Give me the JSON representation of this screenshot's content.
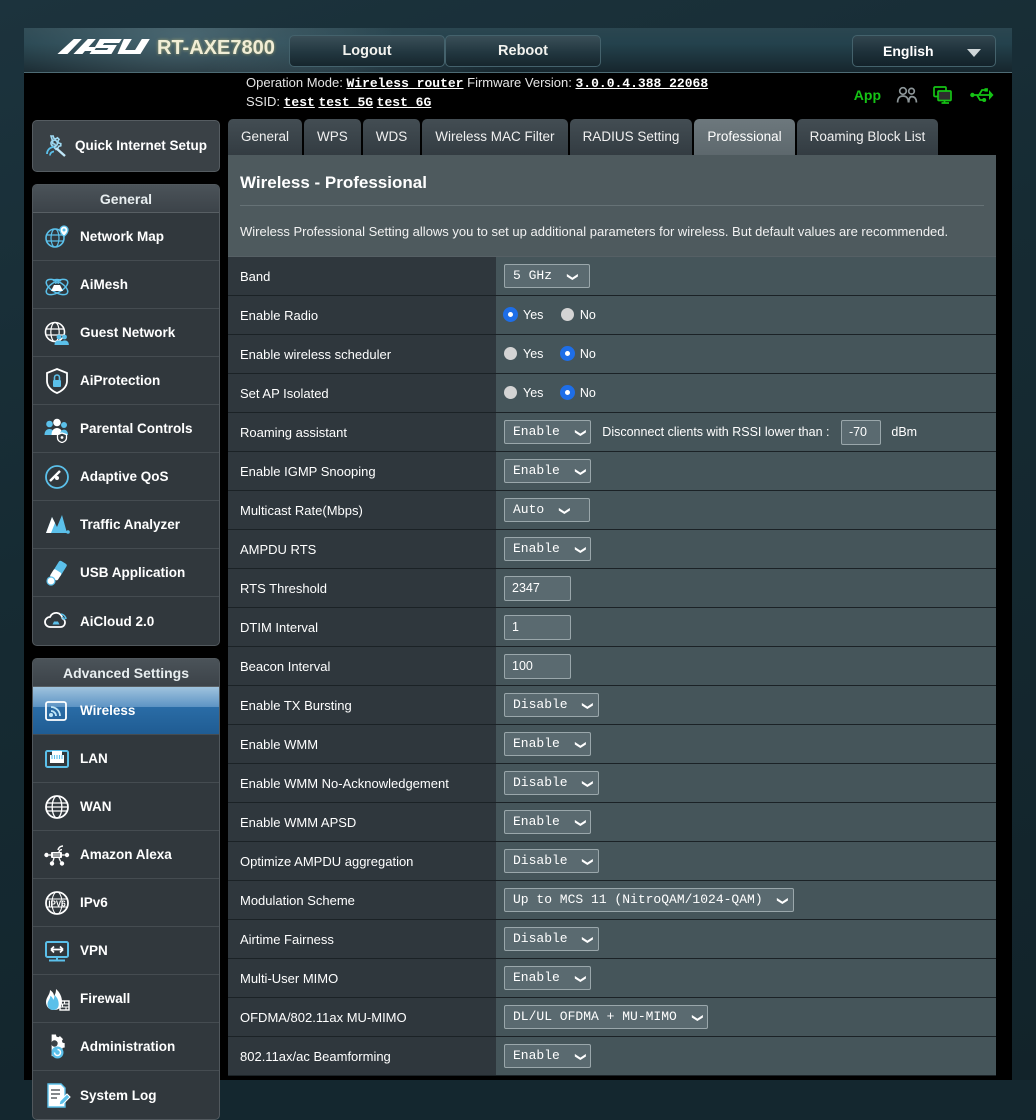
{
  "header": {
    "brand": "/SUS",
    "model": "RT-AXE7800",
    "logout_label": "Logout",
    "reboot_label": "Reboot",
    "language": "English",
    "operation_mode_label": "Operation Mode:",
    "operation_mode_value": "Wireless router",
    "firmware_label": "Firmware Version:",
    "firmware_value": "3.0.0.4.388_22068",
    "ssid_label": "SSID:",
    "ssid_values": [
      "test",
      "test_5G",
      "test_6G"
    ],
    "app_label": "App",
    "icons": [
      "app-link",
      "guest-users-icon",
      "monitor-icon",
      "usb-icon"
    ]
  },
  "sidebar": {
    "quick_internet_setup": "Quick Internet Setup",
    "general_header": "General",
    "general_items": [
      {
        "label": "Network Map",
        "icon": "network-map-icon"
      },
      {
        "label": "AiMesh",
        "icon": "aimesh-icon"
      },
      {
        "label": "Guest Network",
        "icon": "guest-network-icon"
      },
      {
        "label": "AiProtection",
        "icon": "shield-lock-icon"
      },
      {
        "label": "Parental Controls",
        "icon": "parental-controls-icon"
      },
      {
        "label": "Adaptive QoS",
        "icon": "speedometer-icon"
      },
      {
        "label": "Traffic Analyzer",
        "icon": "traffic-analyzer-icon"
      },
      {
        "label": "USB Application",
        "icon": "usb-application-icon"
      },
      {
        "label": "AiCloud 2.0",
        "icon": "cloud-icon"
      }
    ],
    "advanced_header": "Advanced Settings",
    "advanced_items": [
      {
        "label": "Wireless",
        "icon": "wireless-icon",
        "active": true
      },
      {
        "label": "LAN",
        "icon": "lan-port-icon",
        "active": false
      },
      {
        "label": "WAN",
        "icon": "globe-icon",
        "active": false
      },
      {
        "label": "Amazon Alexa",
        "icon": "alexa-icon",
        "active": false
      },
      {
        "label": "IPv6",
        "icon": "ipv6-icon",
        "active": false
      },
      {
        "label": "VPN",
        "icon": "vpn-monitor-icon",
        "active": false
      },
      {
        "label": "Firewall",
        "icon": "firewall-flame-icon",
        "active": false
      },
      {
        "label": "Administration",
        "icon": "administration-gear-icon",
        "active": false
      },
      {
        "label": "System Log",
        "icon": "system-log-icon",
        "active": false
      }
    ]
  },
  "tabs": [
    {
      "label": "General",
      "active": false
    },
    {
      "label": "WPS",
      "active": false
    },
    {
      "label": "WDS",
      "active": false
    },
    {
      "label": "Wireless MAC Filter",
      "active": false
    },
    {
      "label": "RADIUS Setting",
      "active": false
    },
    {
      "label": "Professional",
      "active": true
    },
    {
      "label": "Roaming Block List",
      "active": false
    }
  ],
  "page": {
    "title": "Wireless - Professional",
    "description": "Wireless Professional Setting allows you to set up additional parameters for wireless. But default values are recommended."
  },
  "settings": [
    {
      "key": "Band",
      "type": "select",
      "value": "5 GHz",
      "wide": true
    },
    {
      "key": "Enable Radio",
      "type": "radio",
      "options": [
        "Yes",
        "No"
      ],
      "selected": "Yes"
    },
    {
      "key": "Enable wireless scheduler",
      "type": "radio",
      "options": [
        "Yes",
        "No"
      ],
      "selected": "No"
    },
    {
      "key": "Set AP Isolated",
      "type": "radio",
      "options": [
        "Yes",
        "No"
      ],
      "selected": "No"
    },
    {
      "key": "Roaming assistant",
      "type": "select_note_input",
      "value": "Enable",
      "note": "Disconnect clients with RSSI lower than :",
      "input_value": "-70",
      "unit": "dBm",
      "wide": true
    },
    {
      "key": "Enable IGMP Snooping",
      "type": "select",
      "value": "Enable",
      "wide": true
    },
    {
      "key": "Multicast Rate(Mbps)",
      "type": "select",
      "value": "Auto",
      "wide": true
    },
    {
      "key": "AMPDU RTS",
      "type": "select",
      "value": "Enable",
      "wide": true
    },
    {
      "key": "RTS Threshold",
      "type": "input",
      "value": "2347"
    },
    {
      "key": "DTIM Interval",
      "type": "input",
      "value": "1"
    },
    {
      "key": "Beacon Interval",
      "type": "input",
      "value": "100"
    },
    {
      "key": "Enable TX Bursting",
      "type": "select",
      "value": "Disable",
      "wide": false
    },
    {
      "key": "Enable WMM",
      "type": "select",
      "value": "Enable",
      "wide": false
    },
    {
      "key": "Enable WMM No-Acknowledgement",
      "type": "select",
      "value": "Disable",
      "wide": false
    },
    {
      "key": "Enable WMM APSD",
      "type": "select",
      "value": "Enable",
      "wide": true
    },
    {
      "key": "Optimize AMPDU aggregation",
      "type": "select",
      "value": "Disable",
      "wide": false
    },
    {
      "key": "Modulation Scheme",
      "type": "select",
      "value": "Up to MCS 11 (NitroQAM/1024-QAM)",
      "wide": false
    },
    {
      "key": "Airtime Fairness",
      "type": "select",
      "value": "Disable",
      "wide": false
    },
    {
      "key": "Multi-User MIMO",
      "type": "select",
      "value": "Enable",
      "wide": true
    },
    {
      "key": "OFDMA/802.11ax MU-MIMO",
      "type": "select",
      "value": "DL/UL OFDMA + MU-MIMO",
      "wide": false
    },
    {
      "key": "802.11ax/ac Beamforming",
      "type": "select",
      "value": "Enable",
      "wide": true
    }
  ]
}
